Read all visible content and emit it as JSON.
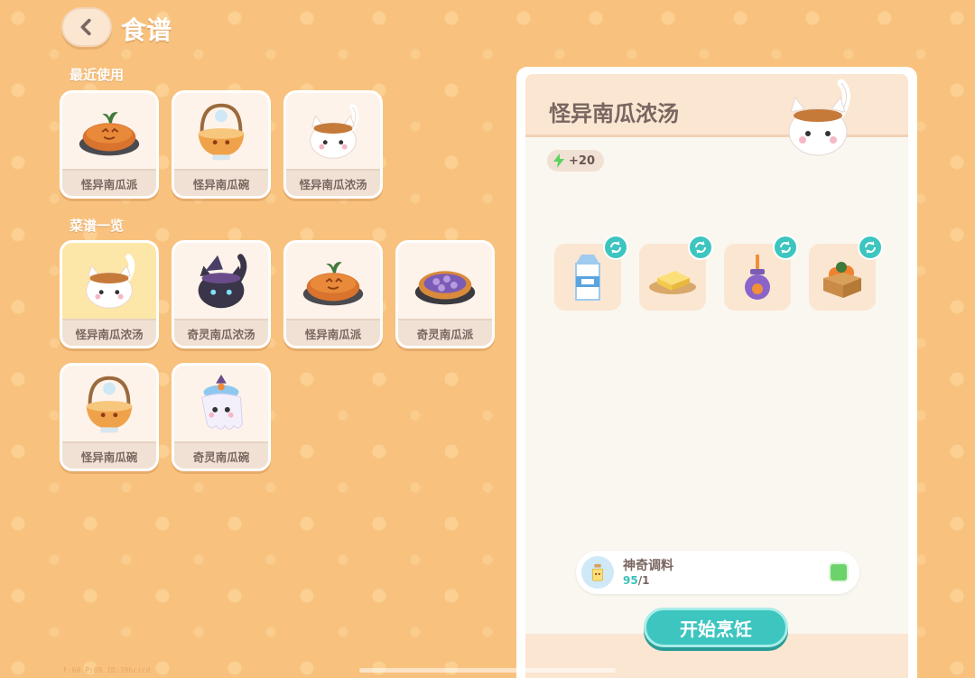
{
  "header": {
    "title": "食谱"
  },
  "recent": {
    "title": "最近使用",
    "items": [
      {
        "label": "怪异南瓜派",
        "icon": "pumpkin-pie-icon"
      },
      {
        "label": "怪异南瓜碗",
        "icon": "pumpkin-bowl-icon"
      },
      {
        "label": "怪异南瓜浓汤",
        "icon": "cat-soup-icon"
      }
    ]
  },
  "catalog": {
    "title": "菜谱一览",
    "items": [
      {
        "label": "怪异南瓜浓汤",
        "icon": "cat-soup-icon",
        "selected": true
      },
      {
        "label": "奇灵南瓜浓汤",
        "icon": "black-cat-soup-icon"
      },
      {
        "label": "怪异南瓜派",
        "icon": "pumpkin-pie-icon"
      },
      {
        "label": "奇灵南瓜派",
        "icon": "purple-pie-icon"
      },
      {
        "label": "怪异南瓜碗",
        "icon": "pumpkin-bowl-icon"
      },
      {
        "label": "奇灵南瓜碗",
        "icon": "ghost-bowl-icon"
      }
    ]
  },
  "detail": {
    "name": "怪异南瓜浓汤",
    "energy": "+20",
    "ingredients": [
      {
        "icon": "milk-carton-icon"
      },
      {
        "icon": "butter-icon"
      },
      {
        "icon": "jam-jar-icon"
      },
      {
        "icon": "pumpkin-crate-icon"
      }
    ],
    "seasoning": {
      "name": "神奇调料",
      "have": "95",
      "need": "/1",
      "enabled": true
    },
    "cook_label": "开始烹饪"
  },
  "debug": "F:60  P:89  ID:39hcicd",
  "colors": {
    "accent": "#3dc5c0",
    "background": "#f8c27e",
    "toggle": "#6cd36a"
  }
}
